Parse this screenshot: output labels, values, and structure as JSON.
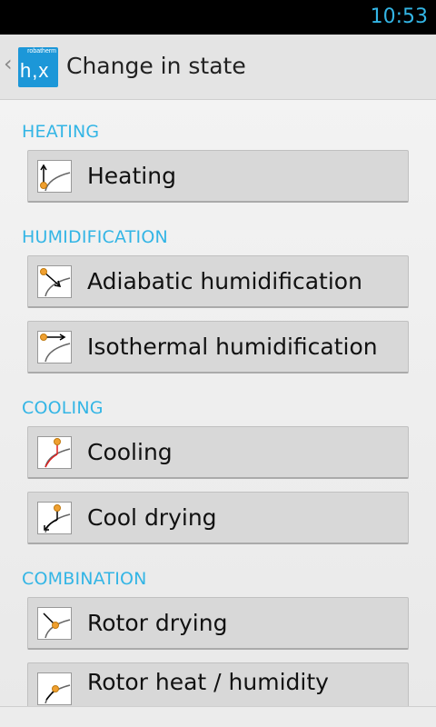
{
  "status_bar": {
    "time": "10:53"
  },
  "action_bar": {
    "title": "Change in state",
    "logo_brand": "robatherm",
    "logo_mark": "h,x",
    "up_glyph": "‹"
  },
  "sections": [
    {
      "header": "HEATING",
      "items": [
        {
          "label": "Heating",
          "icon": "heating-icon"
        }
      ]
    },
    {
      "header": "HUMIDIFICATION",
      "items": [
        {
          "label": "Adiabatic humidification",
          "icon": "adiabatic-humidification-icon"
        },
        {
          "label": "Isothermal humidification",
          "icon": "isothermal-humidification-icon"
        }
      ]
    },
    {
      "header": "COOLING",
      "items": [
        {
          "label": "Cooling",
          "icon": "cooling-icon"
        },
        {
          "label": "Cool drying",
          "icon": "cool-drying-icon"
        }
      ]
    },
    {
      "header": "COMBINATION",
      "items": [
        {
          "label": "Rotor drying",
          "icon": "rotor-drying-icon"
        },
        {
          "label": "Rotor heat / humidity",
          "icon": "rotor-heat-humidity-icon"
        }
      ]
    }
  ],
  "colors": {
    "accent": "#33b5e5",
    "marker": "#f0a030",
    "cooling_line": "#e02020",
    "logo_bg": "#1c97d8"
  }
}
